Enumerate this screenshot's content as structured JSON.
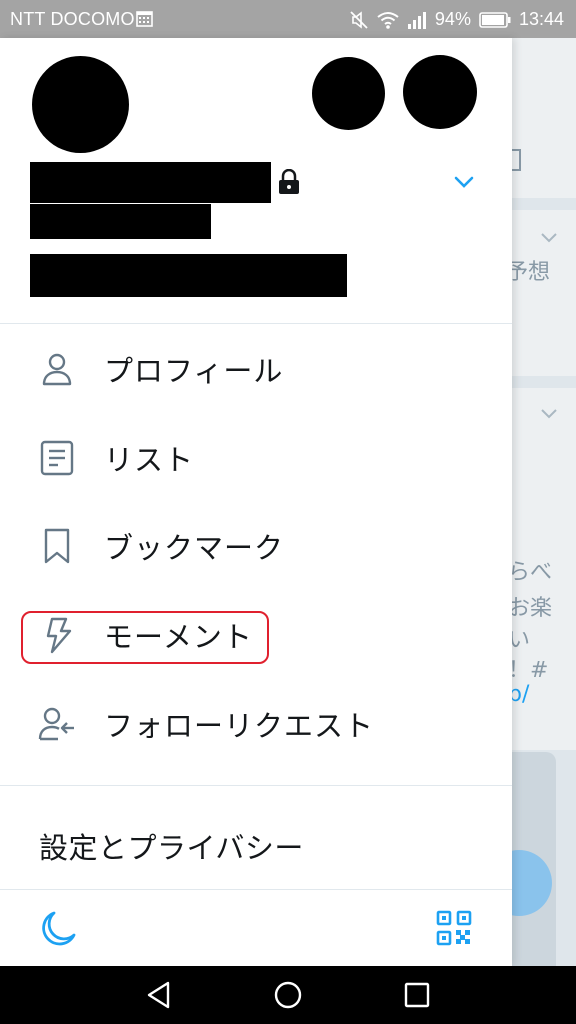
{
  "status_bar": {
    "carrier": "NTT DOCOMO",
    "battery_percent": "94%",
    "time": "13:44"
  },
  "background_app": {
    "snippets": [
      "予想",
      "らべ",
      "お楽",
      "い",
      "！#",
      "p/"
    ]
  },
  "drawer": {
    "menu": [
      {
        "id": "profile",
        "label": "プロフィール",
        "icon": "person-icon"
      },
      {
        "id": "lists",
        "label": "リスト",
        "icon": "list-icon"
      },
      {
        "id": "bookmarks",
        "label": "ブックマーク",
        "icon": "bookmark-icon"
      },
      {
        "id": "moments",
        "label": "モーメント",
        "icon": "lightning-icon"
      },
      {
        "id": "follow-requests",
        "label": "フォローリクエスト",
        "icon": "person-arrow-icon"
      }
    ],
    "settings_label": "設定とプライバシー",
    "footer": {
      "left_icon": "moon-icon",
      "right_icon": "qr-code-icon"
    }
  },
  "colors": {
    "accent": "#1da1f2",
    "icon_gray": "#657786",
    "highlight": "#e0202e"
  }
}
